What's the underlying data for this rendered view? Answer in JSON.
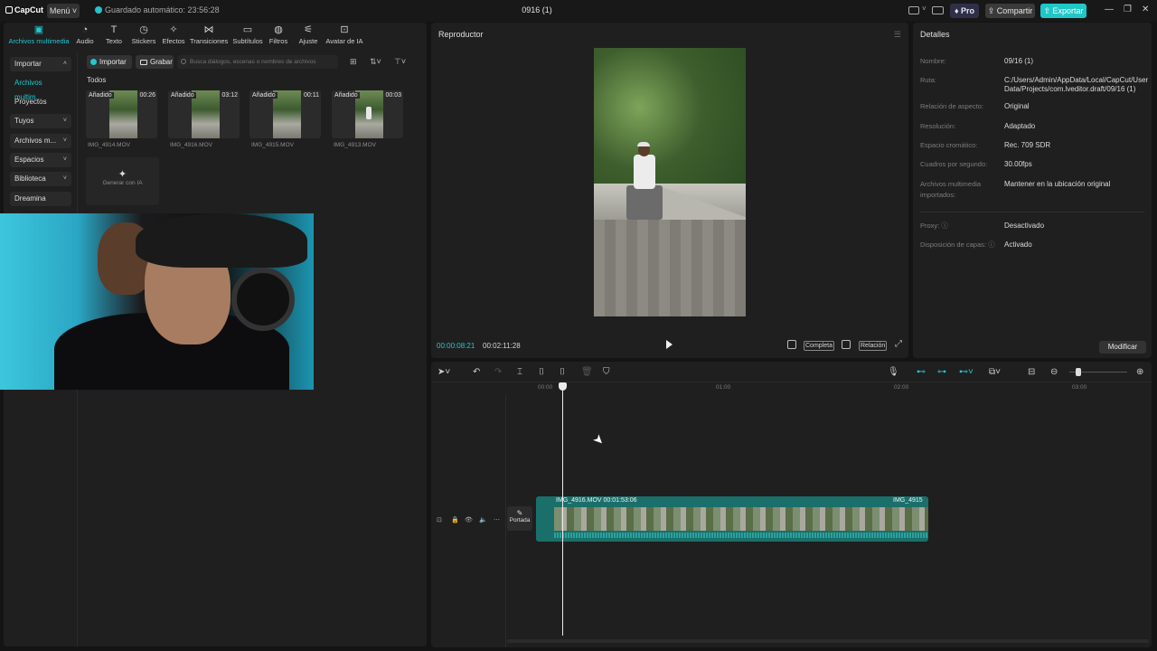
{
  "titlebar": {
    "logo": "CapCut",
    "menu": "Menú",
    "autosave": "Guardado automático: 23:56:28",
    "project_title": "0916 (1)",
    "pro": "Pro",
    "share": "Compartir",
    "export": "Exportar"
  },
  "media": {
    "tabs": [
      {
        "label": "Archivos multimedia",
        "icon": "media-icon"
      },
      {
        "label": "Audio",
        "icon": "audio-icon"
      },
      {
        "label": "Texto",
        "icon": "text-icon"
      },
      {
        "label": "Stickers",
        "icon": "stickers-icon"
      },
      {
        "label": "Efectos",
        "icon": "effects-icon"
      },
      {
        "label": "Transiciones",
        "icon": "transitions-icon"
      },
      {
        "label": "Subtítulos",
        "icon": "subtitles-icon"
      },
      {
        "label": "Filtros",
        "icon": "filters-icon"
      },
      {
        "label": "Ajuste",
        "icon": "adjust-icon"
      },
      {
        "label": "Avatar de IA",
        "icon": "avatar-icon"
      }
    ],
    "nav": [
      "Importar",
      "Archivos multim...",
      "Proyectos secun...",
      "Tuyos",
      "Archivos m...",
      "Espacios",
      "Biblioteca",
      "Dreamina"
    ],
    "import_btn": "Importar",
    "record_btn": "Grabar",
    "search_placeholder": "Busca diálogos, escenas o nombres de archivos",
    "section": "Todos",
    "items": [
      {
        "tag": "Añadido",
        "duration": "00:26",
        "name": "IMG_4914.MOV"
      },
      {
        "tag": "Añadido",
        "duration": "03:12",
        "name": "IMG_4916.MOV"
      },
      {
        "tag": "Añadido",
        "duration": "00:11",
        "name": "IMG_4915.MOV"
      },
      {
        "tag": "Añadido",
        "duration": "00:03",
        "name": "IMG_4913.MOV"
      }
    ],
    "generate_ai": "Generar con IA"
  },
  "player": {
    "title": "Reproductor",
    "current_time": "00:00:08:21",
    "total_time": "00:02:11:28",
    "full_label": "Completa",
    "ratio_label": "Relación"
  },
  "details": {
    "title": "Detalles",
    "rows": [
      {
        "label": "Nombre:",
        "value": "09/16 (1)"
      },
      {
        "label": "Ruta:",
        "value": "C:/Users/Admin/AppData/Local/CapCut/User Data/Projects/com.lveditor.draft/09/16 (1)"
      },
      {
        "label": "Relación de aspecto:",
        "value": "Original"
      },
      {
        "label": "Resolución:",
        "value": "Adaptado"
      },
      {
        "label": "Espacio cromático:",
        "value": "Rec. 709 SDR"
      },
      {
        "label": "Cuadros por segundo:",
        "value": "30.00fps"
      },
      {
        "label": "Archivos multimedia importados:",
        "value": "Mantener en la ubicación original"
      },
      {
        "label": "Proxy:",
        "value": "Desactivado"
      },
      {
        "label": "Disposición de capas:",
        "value": "Activado"
      }
    ],
    "modify": "Modificar"
  },
  "timeline": {
    "ruler": [
      "00:00",
      "01:00",
      "02:00",
      "03:00"
    ],
    "cover": "Portada",
    "clip_label": "IMG_4916.MOV  00:01:53:06",
    "clip_label2": "IMG_4915"
  },
  "colors": {
    "accent": "#22c8d0",
    "export": "#1fc7c7",
    "clip": "#1b6f6b"
  }
}
